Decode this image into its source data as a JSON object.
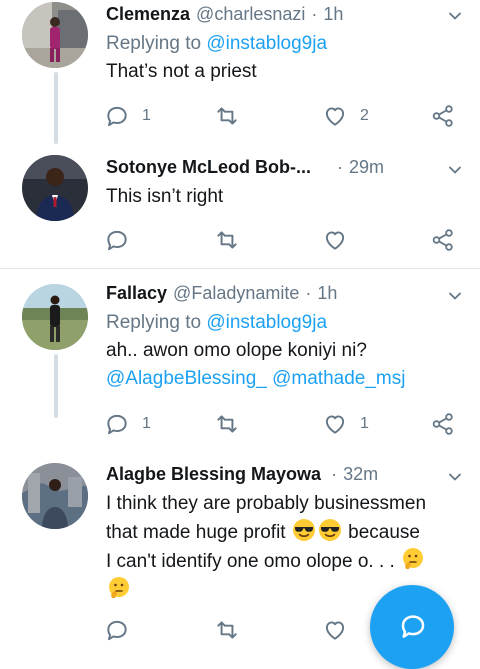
{
  "tweets": [
    {
      "name": "Clemenza",
      "handle": "@charlesnazi",
      "time": "1h",
      "replying_label": "Replying to",
      "replying_handle": "@instablog9ja",
      "lines": [
        "That’s not a priest"
      ],
      "replies": "1",
      "likes": "2"
    },
    {
      "name": "Sotonye McLeod Bob-...",
      "time": "29m",
      "lines": [
        "This isn’t right"
      ],
      "replies": "",
      "likes": ""
    },
    {
      "name": "Fallacy",
      "handle": "@Faladynamite",
      "time": "1h",
      "replying_label": "Replying to",
      "replying_handle": "@instablog9ja",
      "lines": [
        "ah.. awon omo olope koniyi ni?"
      ],
      "mentions": [
        "@AlagbeBlessing_",
        "@mathade_msj"
      ],
      "replies": "1",
      "likes": "1"
    },
    {
      "name": "Alagbe Blessing Mayowa",
      "time": "32m",
      "lines": [
        "I think they are probably businessmen",
        "that made huge profit",
        "because",
        "I can't identify one omo olope o. . ."
      ],
      "replies": "",
      "likes": ""
    }
  ],
  "separator": "·",
  "icons": {
    "reply": "reply-icon",
    "retweet": "retweet-icon",
    "like": "heart-icon",
    "share": "share-icon",
    "more": "chevron-down-icon",
    "compose": "compose-icon",
    "emoji_cool": "smiling-face-with-sunglasses",
    "emoji_think": "thinking-face"
  },
  "colors": {
    "accent": "#1da1f2",
    "secondary_text": "#657786",
    "thread_line": "#d5dde3"
  }
}
